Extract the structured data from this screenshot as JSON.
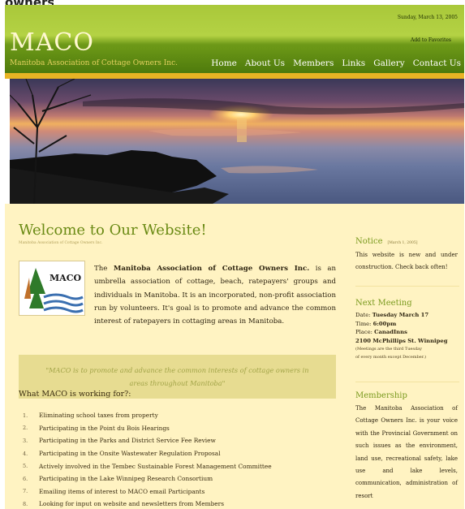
{
  "page_top": {
    "clipped_text": "owners."
  },
  "header": {
    "date": "Sunday, March 13, 2005",
    "add_favorites": "Add to Favorites",
    "logo": "MACO",
    "tagline": "Manitoba Association of Cottage Owners Inc."
  },
  "nav": [
    "Home",
    "About Us",
    "Members",
    "Links",
    "Gallery",
    "Contact Us"
  ],
  "main": {
    "title": "Welcome to Our Website!",
    "subtitle": "Manitoba Association of Cottage Owners Inc.",
    "logo_word": "MACO",
    "intro": {
      "pre": "The ",
      "bold": "Manitoba Association of Cottage Owners Inc.",
      "post": " is an umbrella association of cottage, beach, ratepayers' groups and individuals in Manitoba. It is an incorporated, non-profit association run by volunteers. It's goal is to promote and advance the common interest of ratepayers in cottaging areas in Manitoba."
    },
    "quote": "\"MACO is to promote and advance the common interests of cottage owners in areas throughout Manitoba\"",
    "working_heading": "What MACO is working for?:",
    "working_items": [
      "Eliminating school taxes from property",
      "Participating in the Point du Bois Hearings",
      "Participating in the Parks and District Service Fee Review",
      "Participating in the Onsite Wastewater Regulation Proposal",
      "Actively involved in the Tembec Sustainable Forest Management Committee",
      "Participating in the Lake Winnipeg Research Consortium",
      "Emailing items of interest to MACO email Participants",
      "Looking for input on website and newsletters from Members"
    ]
  },
  "sidebar": {
    "notice": {
      "title": "Notice",
      "date": "[March 1, 2005]",
      "text": "This website is new and under construction. Check back often!"
    },
    "meeting": {
      "title": "Next Meeting",
      "date_label": "Date: ",
      "date_value": "Tuesday March 17",
      "time_label": "Time: ",
      "time_value": "6:00pm",
      "place_label": "Place: ",
      "place_value": "CanadInns",
      "address": "2100 McPhillips St. Winnipeg",
      "note1": "(Meetings are the third Tuesday",
      "note2": "of every month except December.)"
    },
    "membership": {
      "title": "Membership",
      "text": "The Manitoba Association of Cottage Owners Inc. is your voice with the Provincial Government on such issues as the environment, land use, recreational safety, lake use and lake levels, communication, administration of resort"
    }
  }
}
